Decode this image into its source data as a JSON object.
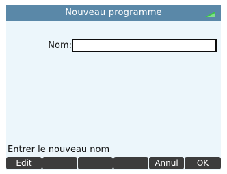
{
  "header": {
    "title": "Nouveau programme",
    "status_icon": "battery-icon",
    "status_icon_color": "#3bc24a"
  },
  "form": {
    "name_label": "Nom:",
    "name_value": ""
  },
  "help": {
    "text": "Entrer le nouveau nom"
  },
  "menu": {
    "keys": [
      "Edit",
      "",
      "",
      "",
      "Annul",
      "OK"
    ]
  },
  "colors": {
    "title_bar": "#5a88a8",
    "screen_bg": "#ecf6fb",
    "softkey_bg": "#3c3c3c"
  }
}
